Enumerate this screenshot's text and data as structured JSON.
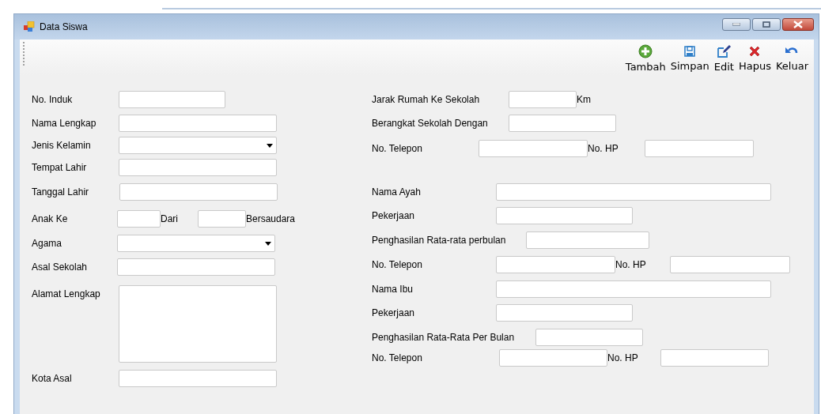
{
  "window": {
    "title": "Data Siswa"
  },
  "toolbar": [
    {
      "label": "Tambah"
    },
    {
      "label": "Simpan"
    },
    {
      "label": "Edit"
    },
    {
      "label": "Hapus"
    },
    {
      "label": "Keluar"
    }
  ],
  "form": {
    "left": [
      {
        "items": [
          {
            "kind": "label",
            "text": "No. Induk"
          },
          {
            "kind": "text"
          }
        ]
      },
      {
        "items": [
          {
            "kind": "label",
            "text": "Nama Lengkap"
          },
          {
            "kind": "text"
          }
        ]
      },
      {
        "items": [
          {
            "kind": "label",
            "text": "Jenis Kelamin"
          },
          {
            "kind": "combo"
          }
        ]
      },
      {
        "items": [
          {
            "kind": "label",
            "text": "Tempat Lahir"
          },
          {
            "kind": "text"
          }
        ]
      },
      {
        "items": [
          {
            "kind": "label",
            "text": "Tanggal Lahir"
          },
          {
            "kind": "text"
          }
        ]
      },
      {
        "items": [
          {
            "kind": "label",
            "text": "Anak Ke"
          },
          {
            "kind": "text"
          },
          {
            "kind": "label",
            "text": "Dari"
          },
          {
            "kind": "text"
          },
          {
            "kind": "label",
            "text": "Bersaudara"
          }
        ]
      },
      {
        "items": [
          {
            "kind": "label",
            "text": "Agama"
          },
          {
            "kind": "combo"
          }
        ]
      },
      {
        "items": [
          {
            "kind": "label",
            "text": "Asal Sekolah"
          },
          {
            "kind": "text"
          }
        ]
      },
      {
        "items": [
          {
            "kind": "label",
            "text": "Alamat Lengkap"
          },
          {
            "kind": "textarea"
          }
        ]
      },
      {
        "items": [
          {
            "kind": "label",
            "text": "Kota Asal"
          },
          {
            "kind": "text"
          }
        ]
      }
    ],
    "right": [
      {
        "items": [
          {
            "kind": "label",
            "text": "Jarak Rumah Ke Sekolah"
          },
          {
            "kind": "text"
          },
          {
            "kind": "label",
            "text": "Km"
          }
        ]
      },
      {
        "items": [
          {
            "kind": "label",
            "text": "Berangkat Sekolah Dengan"
          },
          {
            "kind": "text"
          }
        ]
      },
      {
        "items": [
          {
            "kind": "label",
            "text": "No. Telepon"
          },
          {
            "kind": "text"
          },
          {
            "kind": "label",
            "text": "No. HP"
          },
          {
            "kind": "text"
          }
        ]
      },
      {
        "items": [
          {
            "kind": "label",
            "text": "Nama Ayah"
          },
          {
            "kind": "text"
          }
        ]
      },
      {
        "items": [
          {
            "kind": "label",
            "text": "Pekerjaan"
          },
          {
            "kind": "text"
          }
        ]
      },
      {
        "items": [
          {
            "kind": "label",
            "text": "Penghasilan Rata-rata perbulan"
          },
          {
            "kind": "text"
          }
        ]
      },
      {
        "items": [
          {
            "kind": "label",
            "text": "No. Telepon"
          },
          {
            "kind": "text"
          },
          {
            "kind": "label",
            "text": "No. HP"
          },
          {
            "kind": "text"
          }
        ]
      },
      {
        "items": [
          {
            "kind": "label",
            "text": "Nama Ibu"
          },
          {
            "kind": "text"
          }
        ]
      },
      {
        "items": [
          {
            "kind": "label",
            "text": "Pekerjaan"
          },
          {
            "kind": "text"
          }
        ]
      },
      {
        "items": [
          {
            "kind": "label",
            "text": "Penghasilan Rata-Rata Per Bulan"
          },
          {
            "kind": "text"
          }
        ]
      },
      {
        "items": [
          {
            "kind": "label",
            "text": "No. Telepon"
          },
          {
            "kind": "text"
          },
          {
            "kind": "label",
            "text": "No. HP"
          },
          {
            "kind": "text"
          }
        ]
      }
    ]
  }
}
